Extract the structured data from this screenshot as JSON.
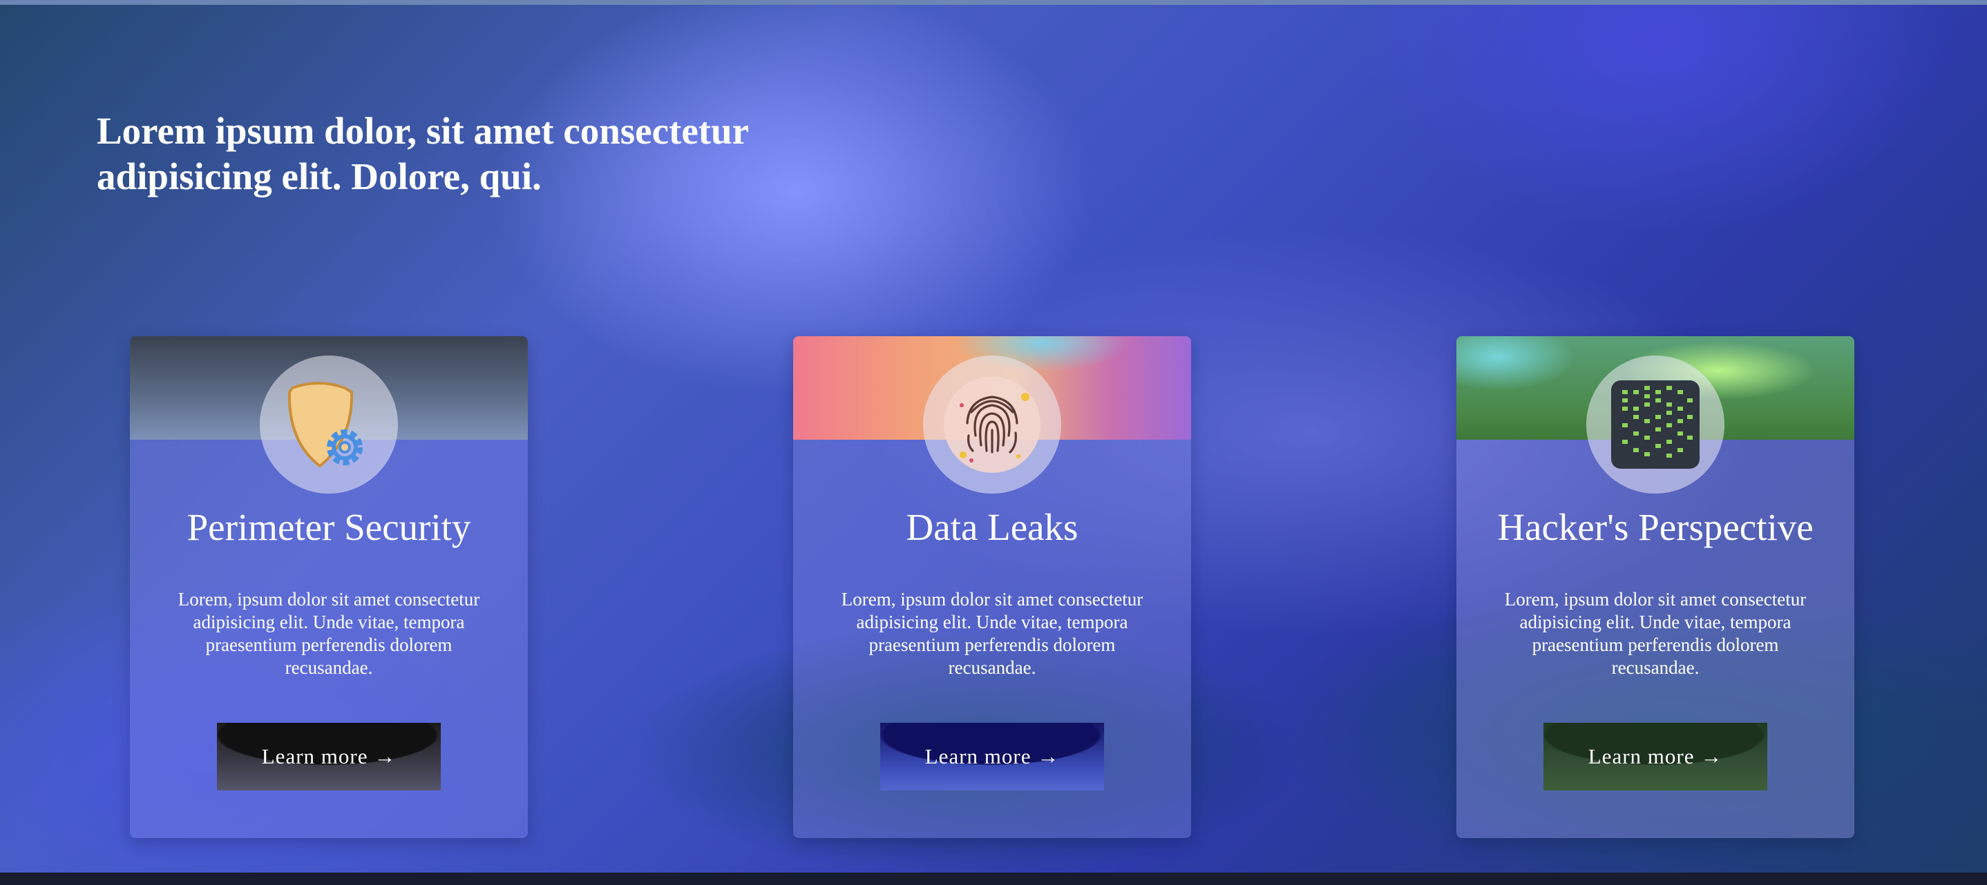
{
  "headline": "Lorem ipsum dolor, sit amet consectetur adipisicing elit. Dolore, qui.",
  "cards": [
    {
      "title": "Perimeter Security",
      "text": "Lorem, ipsum dolor sit amet consectetur adipisicing elit. Unde vitae, tempora praesentium perferendis dolorem recusandae.",
      "button_label": "Learn more →",
      "icon": "shield-gear-icon"
    },
    {
      "title": "Data Leaks",
      "text": "Lorem, ipsum dolor sit amet consectetur adipisicing elit. Unde vitae, tempora praesentium perferendis dolorem recusandae.",
      "button_label": "Learn more →",
      "icon": "fingerprint-icon"
    },
    {
      "title": "Hacker's Perspective",
      "text": "Lorem, ipsum dolor sit amet consectetur adipisicing elit. Unde vitae, tempora praesentium perferendis dolorem recusandae.",
      "button_label": "Learn more →",
      "icon": "matrix-code-icon"
    }
  ],
  "colors": {
    "shield_fill": "#f5cd8a",
    "gear": "#4a90e2",
    "matrix_green": "#8fd35a",
    "matrix_bg": "#2f3640"
  }
}
